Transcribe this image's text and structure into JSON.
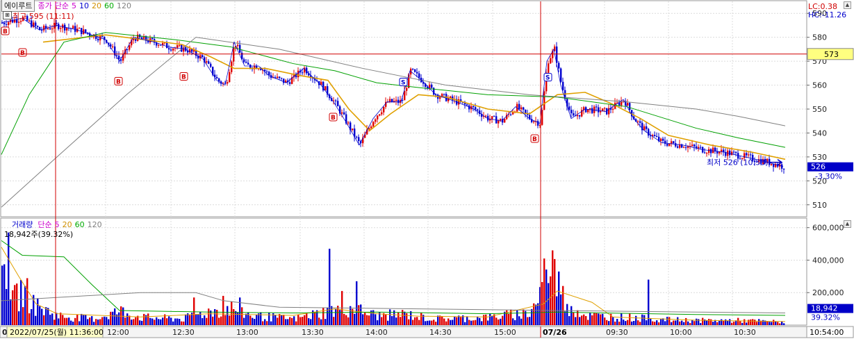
{
  "header": {
    "alert_button": "에이루트",
    "price_label": "종가",
    "ma_label": "단순",
    "ma_periods": [
      "5",
      "10",
      "20",
      "60",
      "120"
    ],
    "ma_colors": [
      "#cc00cc",
      "#0000cc",
      "#e0a000",
      "#00aa00",
      "#808080"
    ],
    "high_note": "최고 595 (11:11)",
    "lc_label": "LC:0.38",
    "hc_label": "HC:-11.26",
    "low_note": "최저 526 (10:53)",
    "current_price": "526",
    "current_change": "-3.30%",
    "crosshair_price": "573"
  },
  "volume_header": {
    "title": "거래량",
    "ma_label": "단순",
    "ma_periods": [
      "5",
      "20",
      "60",
      "120"
    ],
    "value_note": "18,942주(39.32%)",
    "current_volume": "18,942",
    "current_ratio": "39.32%"
  },
  "x_axis": {
    "cursor_label": "2022/07/25(월) 11:36:00",
    "day_change_label": "07/26",
    "first_label": "0",
    "end_time": "10:54:00",
    "ticks": [
      "12:00",
      "12:30",
      "13:00",
      "13:30",
      "14:00",
      "14:30",
      "15:00",
      "09:30",
      "10:00",
      "10:30"
    ]
  },
  "chart_data": [
    {
      "type": "candlestick",
      "yticks": [
        510,
        520,
        530,
        540,
        550,
        560,
        570,
        580,
        590
      ],
      "ylim": [
        505,
        595
      ],
      "high": 595,
      "high_time": "11:11",
      "low": 526,
      "low_time": "10:53",
      "last": 526,
      "crosshair_value": 573,
      "close_path": [
        {
          "x": 0,
          "y": 586
        },
        {
          "x": 30,
          "y": 588
        },
        {
          "x": 55,
          "y": 583
        },
        {
          "x": 80,
          "y": 585
        },
        {
          "x": 110,
          "y": 583
        },
        {
          "x": 150,
          "y": 579
        },
        {
          "x": 170,
          "y": 570
        },
        {
          "x": 190,
          "y": 580
        },
        {
          "x": 220,
          "y": 578
        },
        {
          "x": 240,
          "y": 576
        },
        {
          "x": 265,
          "y": 575
        },
        {
          "x": 290,
          "y": 571
        },
        {
          "x": 310,
          "y": 562
        },
        {
          "x": 322,
          "y": 560
        },
        {
          "x": 335,
          "y": 578
        },
        {
          "x": 350,
          "y": 568
        },
        {
          "x": 370,
          "y": 568
        },
        {
          "x": 385,
          "y": 564
        },
        {
          "x": 410,
          "y": 561
        },
        {
          "x": 435,
          "y": 567
        },
        {
          "x": 460,
          "y": 560
        },
        {
          "x": 478,
          "y": 553
        },
        {
          "x": 495,
          "y": 545
        },
        {
          "x": 515,
          "y": 535
        },
        {
          "x": 535,
          "y": 546
        },
        {
          "x": 555,
          "y": 553
        },
        {
          "x": 575,
          "y": 553
        },
        {
          "x": 588,
          "y": 566
        },
        {
          "x": 605,
          "y": 562
        },
        {
          "x": 625,
          "y": 556
        },
        {
          "x": 655,
          "y": 553
        },
        {
          "x": 680,
          "y": 550
        },
        {
          "x": 700,
          "y": 546
        },
        {
          "x": 720,
          "y": 545
        },
        {
          "x": 740,
          "y": 551
        },
        {
          "x": 760,
          "y": 546
        },
        {
          "x": 775,
          "y": 544
        },
        {
          "x": 785,
          "y": 570
        },
        {
          "x": 795,
          "y": 575
        },
        {
          "x": 805,
          "y": 560
        },
        {
          "x": 820,
          "y": 546
        },
        {
          "x": 840,
          "y": 550
        },
        {
          "x": 870,
          "y": 549
        },
        {
          "x": 895,
          "y": 554
        },
        {
          "x": 910,
          "y": 546
        },
        {
          "x": 925,
          "y": 541
        },
        {
          "x": 950,
          "y": 536
        },
        {
          "x": 980,
          "y": 535
        },
        {
          "x": 1010,
          "y": 533
        },
        {
          "x": 1040,
          "y": 532
        },
        {
          "x": 1070,
          "y": 530
        },
        {
          "x": 1100,
          "y": 528
        },
        {
          "x": 1125,
          "y": 526
        }
      ],
      "ma_paths": [
        {
          "name": "20",
          "points": [
            {
              "x": 60,
              "y": 578
            },
            {
              "x": 150,
              "y": 581
            },
            {
              "x": 260,
              "y": 577
            },
            {
              "x": 300,
              "y": 572
            },
            {
              "x": 335,
              "y": 567
            },
            {
              "x": 380,
              "y": 567
            },
            {
              "x": 430,
              "y": 564
            },
            {
              "x": 470,
              "y": 562
            },
            {
              "x": 500,
              "y": 550
            },
            {
              "x": 530,
              "y": 541
            },
            {
              "x": 560,
              "y": 548
            },
            {
              "x": 600,
              "y": 556
            },
            {
              "x": 640,
              "y": 555
            },
            {
              "x": 700,
              "y": 550
            },
            {
              "x": 760,
              "y": 548
            },
            {
              "x": 800,
              "y": 556
            },
            {
              "x": 840,
              "y": 557
            },
            {
              "x": 880,
              "y": 552
            },
            {
              "x": 920,
              "y": 546
            },
            {
              "x": 960,
              "y": 539
            },
            {
              "x": 1020,
              "y": 535
            },
            {
              "x": 1080,
              "y": 532
            },
            {
              "x": 1128,
              "y": 529
            }
          ]
        },
        {
          "name": "60",
          "points": [
            {
              "x": 0,
              "y": 531
            },
            {
              "x": 40,
              "y": 556
            },
            {
              "x": 90,
              "y": 578
            },
            {
              "x": 150,
              "y": 582
            },
            {
              "x": 250,
              "y": 579
            },
            {
              "x": 330,
              "y": 576
            },
            {
              "x": 420,
              "y": 569
            },
            {
              "x": 480,
              "y": 566
            },
            {
              "x": 540,
              "y": 561
            },
            {
              "x": 600,
              "y": 559
            },
            {
              "x": 700,
              "y": 556
            },
            {
              "x": 800,
              "y": 555
            },
            {
              "x": 900,
              "y": 551
            },
            {
              "x": 1000,
              "y": 542
            },
            {
              "x": 1060,
              "y": 538
            },
            {
              "x": 1128,
              "y": 534
            }
          ]
        },
        {
          "name": "120",
          "points": [
            {
              "x": 0,
              "y": 509
            },
            {
              "x": 80,
              "y": 530
            },
            {
              "x": 180,
              "y": 556
            },
            {
              "x": 280,
              "y": 580
            },
            {
              "x": 400,
              "y": 575
            },
            {
              "x": 520,
              "y": 567
            },
            {
              "x": 640,
              "y": 560
            },
            {
              "x": 760,
              "y": 556
            },
            {
              "x": 900,
              "y": 553
            },
            {
              "x": 1000,
              "y": 550
            },
            {
              "x": 1060,
              "y": 547
            },
            {
              "x": 1128,
              "y": 543
            }
          ]
        }
      ],
      "signals": [
        {
          "label": "B",
          "x": 5,
          "y": 586
        },
        {
          "label": "B",
          "x": 30,
          "y": 577
        },
        {
          "label": "B",
          "x": 168,
          "y": 565
        },
        {
          "label": "B",
          "x": 262,
          "y": 567
        },
        {
          "label": "B",
          "x": 477,
          "y": 550
        },
        {
          "label": "S",
          "x": 578,
          "y": 560
        },
        {
          "label": "B",
          "x": 767,
          "y": 541
        },
        {
          "label": "S",
          "x": 786,
          "y": 562
        }
      ]
    },
    {
      "type": "bar",
      "title": "거래량",
      "yticks": [
        200000,
        400000,
        600000
      ],
      "ylim": [
        0,
        650000
      ],
      "last": 18942,
      "volume_profile": [
        {
          "x": 0,
          "v": 250000
        },
        {
          "x": 6,
          "v": 480000
        },
        {
          "x": 15,
          "v": 150000
        },
        {
          "x": 30,
          "v": 230000
        },
        {
          "x": 50,
          "v": 120000
        },
        {
          "x": 80,
          "v": 60000
        },
        {
          "x": 130,
          "v": 40000
        },
        {
          "x": 170,
          "v": 90000
        },
        {
          "x": 200,
          "v": 50000
        },
        {
          "x": 260,
          "v": 40000
        },
        {
          "x": 300,
          "v": 90000
        },
        {
          "x": 330,
          "v": 110000
        },
        {
          "x": 360,
          "v": 60000
        },
        {
          "x": 420,
          "v": 40000
        },
        {
          "x": 470,
          "v": 90000
        },
        {
          "x": 500,
          "v": 110000
        },
        {
          "x": 540,
          "v": 60000
        },
        {
          "x": 580,
          "v": 70000
        },
        {
          "x": 620,
          "v": 40000
        },
        {
          "x": 700,
          "v": 50000
        },
        {
          "x": 760,
          "v": 80000
        },
        {
          "x": 790,
          "v": 350000
        },
        {
          "x": 810,
          "v": 150000
        },
        {
          "x": 840,
          "v": 60000
        },
        {
          "x": 900,
          "v": 50000
        },
        {
          "x": 950,
          "v": 35000
        },
        {
          "x": 1000,
          "v": 30000
        },
        {
          "x": 1060,
          "v": 30000
        },
        {
          "x": 1128,
          "v": 20000
        }
      ],
      "spikes": [
        {
          "x": 8,
          "v": 570000
        },
        {
          "x": 470,
          "v": 470000
        },
        {
          "x": 488,
          "v": 210000
        },
        {
          "x": 510,
          "v": 270000
        },
        {
          "x": 780,
          "v": 410000
        },
        {
          "x": 788,
          "v": 300000
        },
        {
          "x": 793,
          "v": 460000
        },
        {
          "x": 800,
          "v": 330000
        },
        {
          "x": 930,
          "v": 280000
        },
        {
          "x": 275,
          "v": 170000
        },
        {
          "x": 319,
          "v": 180000
        },
        {
          "x": 342,
          "v": 170000
        }
      ],
      "ma_paths": [
        {
          "name": "20",
          "points": [
            {
              "x": 0,
              "v": 480000
            },
            {
              "x": 25,
              "v": 300000
            },
            {
              "x": 50,
              "v": 130000
            },
            {
              "x": 80,
              "v": 70000
            },
            {
              "x": 200,
              "v": 50000
            },
            {
              "x": 300,
              "v": 70000
            },
            {
              "x": 420,
              "v": 60000
            },
            {
              "x": 480,
              "v": 100000
            },
            {
              "x": 540,
              "v": 70000
            },
            {
              "x": 600,
              "v": 55000
            },
            {
              "x": 700,
              "v": 50000
            },
            {
              "x": 780,
              "v": 130000
            },
            {
              "x": 800,
              "v": 210000
            },
            {
              "x": 850,
              "v": 140000
            },
            {
              "x": 880,
              "v": 50000
            },
            {
              "x": 1000,
              "v": 30000
            },
            {
              "x": 1128,
              "v": 22000
            }
          ]
        },
        {
          "name": "60",
          "points": [
            {
              "x": 0,
              "v": 520000
            },
            {
              "x": 30,
              "v": 430000
            },
            {
              "x": 90,
              "v": 420000
            },
            {
              "x": 130,
              "v": 250000
            },
            {
              "x": 170,
              "v": 90000
            },
            {
              "x": 300,
              "v": 80000
            },
            {
              "x": 420,
              "v": 75000
            },
            {
              "x": 540,
              "v": 80000
            },
            {
              "x": 700,
              "v": 70000
            },
            {
              "x": 800,
              "v": 80000
            },
            {
              "x": 1000,
              "v": 65000
            },
            {
              "x": 1128,
              "v": 60000
            }
          ]
        },
        {
          "name": "120",
          "points": [
            {
              "x": 0,
              "v": 150000
            },
            {
              "x": 120,
              "v": 180000
            },
            {
              "x": 200,
              "v": 200000
            },
            {
              "x": 280,
              "v": 200000
            },
            {
              "x": 320,
              "v": 150000
            },
            {
              "x": 400,
              "v": 110000
            },
            {
              "x": 600,
              "v": 100000
            },
            {
              "x": 800,
              "v": 90000
            },
            {
              "x": 1000,
              "v": 80000
            },
            {
              "x": 1128,
              "v": 75000
            }
          ]
        }
      ]
    }
  ]
}
